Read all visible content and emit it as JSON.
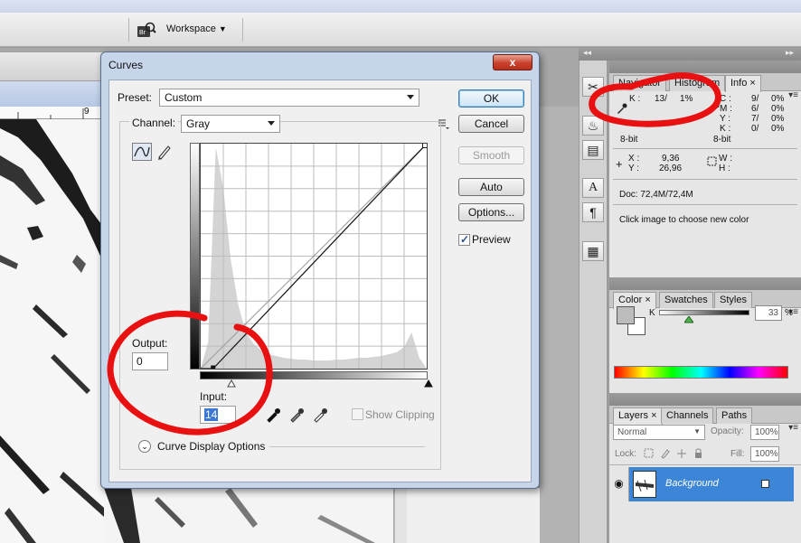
{
  "app": {
    "workspace_label": "Workspace"
  },
  "dialog": {
    "title": "Curves",
    "close_glyph": "x",
    "preset_label": "Preset:",
    "preset_value": "Custom",
    "channel_label": "Channel:",
    "channel_value": "Gray",
    "output_label": "Output:",
    "output_value": "0",
    "input_label": "Input:",
    "input_value": "14",
    "show_clipping_label": "Show Clipping",
    "curve_display_options_label": "Curve Display Options",
    "preview_label": "Preview",
    "preview_checked": true,
    "buttons": {
      "ok": "OK",
      "cancel": "Cancel",
      "smooth": "Smooth",
      "auto": "Auto",
      "options": "Options..."
    },
    "curve": {
      "input_black_point": 14,
      "output_black_point": 0,
      "input_white_point": 255,
      "output_white_point": 255
    }
  },
  "info_panel": {
    "tabs": [
      "Navigator",
      "Histogram",
      "Info"
    ],
    "active_tab": "Info",
    "k_label": "K :",
    "k_before": "13/",
    "k_after": "1%",
    "cmyk_labels": [
      "C :",
      "M :",
      "Y :",
      "K :"
    ],
    "cmyk_values": [
      "9/",
      "6/",
      "7/",
      "0/"
    ],
    "cmyk_after": [
      "0%",
      "0%",
      "0%",
      "0%"
    ],
    "bit_depth_left": "8-bit",
    "bit_depth_right": "8-bit",
    "x_label": "X :",
    "y_label": "Y :",
    "x_value": "9,36",
    "y_value": "26,96",
    "w_label": "W :",
    "h_label": "H :",
    "doc_size": "Doc: 72,4M/72,4M",
    "hint": "Click image to choose new color"
  },
  "color_panel": {
    "tabs": [
      "Color",
      "Swatches",
      "Styles"
    ],
    "active_tab": "Color",
    "k_label": "K",
    "k_value": "33",
    "k_unit": "%",
    "k_level": 0.33
  },
  "layers_panel": {
    "tabs": [
      "Layers",
      "Channels",
      "Paths"
    ],
    "active_tab": "Layers",
    "blend_mode": "Normal",
    "opacity_label": "Opacity:",
    "opacity_value": "100%",
    "lock_label": "Lock:",
    "fill_label": "Fill:",
    "fill_value": "100%",
    "layer_name": "Background"
  },
  "ruler": {
    "tick_label": "9"
  },
  "colors": {
    "annotation_red": "#e81010",
    "selection_blue": "#3d85d6",
    "histogram_gray": "#d4d4d4"
  }
}
